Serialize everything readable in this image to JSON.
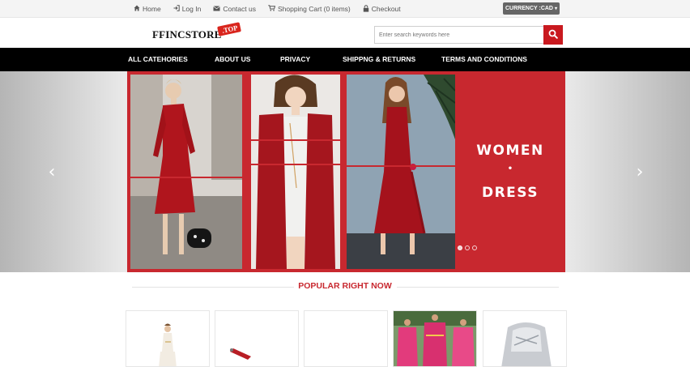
{
  "topbar": {
    "links": [
      {
        "label": "Home",
        "icon": "home-icon"
      },
      {
        "label": "Log In",
        "icon": "login-icon"
      },
      {
        "label": "Contact us",
        "icon": "envelope-icon"
      },
      {
        "label": "Shopping Cart (0 items)",
        "icon": "cart-icon"
      },
      {
        "label": "Checkout",
        "icon": "lock-icon"
      }
    ],
    "currency_label": "CURRENCY :CAD"
  },
  "header": {
    "logo_text": "FFINCSTORE",
    "logo_tag": ".TOP",
    "search_placeholder": "Enter search keywords here"
  },
  "nav": {
    "items": [
      "ALL CATEHORIES",
      "ABOUT US",
      "PRIVACY",
      "SHIPPNG & RETURNS",
      "TERMS AND CONDITIONS"
    ]
  },
  "hero": {
    "line1": "WOMEN",
    "line2": "•",
    "line3": "DRESS",
    "prev_arrow": "‹",
    "next_arrow": "›"
  },
  "popular": {
    "title": "POPULAR RIGHT NOW"
  },
  "colors": {
    "accent_red": "#c8282f",
    "nav_bg": "#000000",
    "currency_bg": "#666666"
  }
}
